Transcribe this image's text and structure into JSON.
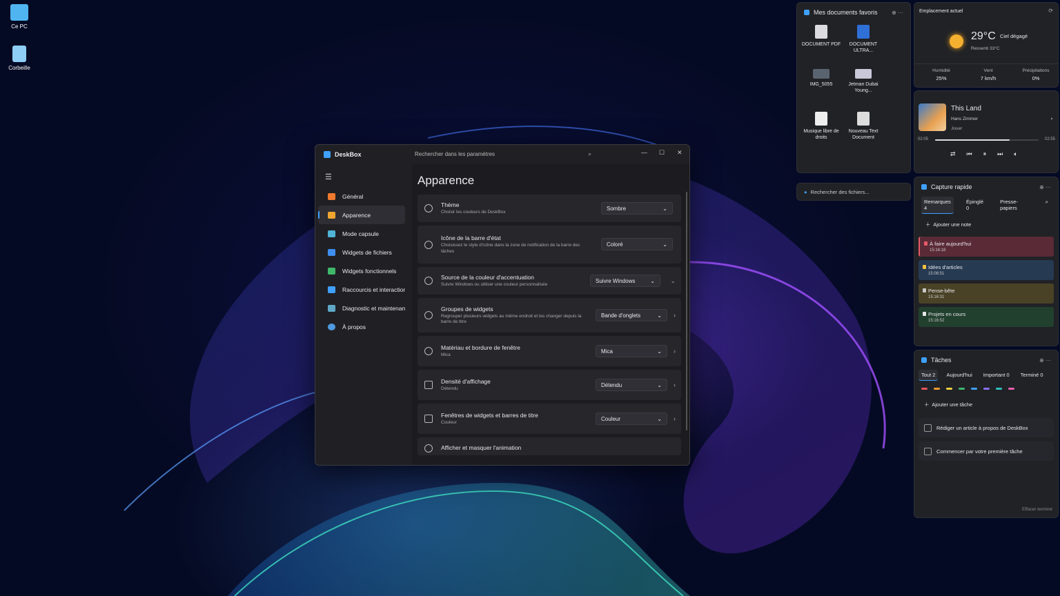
{
  "desktop": {
    "icons": [
      {
        "label": "Ce PC",
        "icon": "monitor-icon",
        "color": "#4fb4f0"
      },
      {
        "label": "Corbeille",
        "icon": "recycle-bin-icon",
        "color": "#8ecdf5"
      }
    ]
  },
  "window": {
    "app_title": "DeskBox",
    "search_placeholder": "Rechercher dans les paramètres",
    "minimize": "—",
    "maximize": "☐",
    "close": "✕",
    "nav": [
      {
        "label": "Général",
        "color": "#f07a2e"
      },
      {
        "label": "Apparence",
        "color": "#f0a530"
      },
      {
        "label": "Mode capsule",
        "color": "#4fb4d8"
      },
      {
        "label": "Widgets de fichiers",
        "color": "#3f8ef0"
      },
      {
        "label": "Widgets fonctionnels",
        "color": "#3fb86a"
      },
      {
        "label": "Raccourcis et interactions",
        "color": "#3fa0ff"
      },
      {
        "label": "Diagnostic et maintenance",
        "color": "#5fa8c8"
      },
      {
        "label": "À propos",
        "color": "#4f9ae0"
      }
    ],
    "page_title": "Apparence",
    "settings": [
      {
        "title": "Thème",
        "sub": "Choisir les couleurs de DeskBox",
        "value": "Sombre",
        "arrow": ""
      },
      {
        "title": "Icône de la barre d'état",
        "sub": "Choisissez le style d'icône dans la zone de notification de la barre des tâches",
        "value": "Coloré",
        "arrow": ""
      },
      {
        "title": "Source de la couleur d'accentuation",
        "sub": "Suivre Windows ou utiliser une couleur personnalisée",
        "value": "Suivre Windows",
        "arrow": "⌄"
      },
      {
        "title": "Groupes de widgets",
        "sub": "Regrouper plusieurs widgets au même endroit et les changer depuis la barre de titre",
        "value": "Bande d'onglets",
        "arrow": "›"
      },
      {
        "title": "Matériau et bordure de fenêtre",
        "sub": "Mica",
        "value": "Mica",
        "arrow": "›"
      },
      {
        "title": "Densité d'affichage",
        "sub": "Détendu",
        "value": "Détendu",
        "arrow": "›"
      },
      {
        "title": "Fenêtres de widgets et barres de titre",
        "sub": "Couleur",
        "value": "Couleur",
        "arrow": "›"
      },
      {
        "title": "Afficher et masquer l'animation",
        "sub": "",
        "value": "",
        "arrow": ""
      }
    ]
  },
  "favorites": {
    "title": "Mes documents favoris",
    "docs": [
      {
        "label": "DOCUMENT PDF",
        "color": "#dcdce0"
      },
      {
        "label": "DOCUMENT ULTRA...",
        "color": "#2f6fd8"
      },
      {
        "label": "IMG_5055",
        "color": "#5a6470"
      },
      {
        "label": "Jetman Dubai Young...",
        "color": "#c8c8d8"
      },
      {
        "label": "Musique libre de droits",
        "color": "#eeeeee"
      },
      {
        "label": "Nouveau Text Document",
        "color": "#dddddd"
      }
    ]
  },
  "file_search": {
    "placeholder": "Rechercher des fichiers..."
  },
  "weather": {
    "location": "Emplacement actuel",
    "temp": "29°C",
    "condition": "Ciel dégagé",
    "feels": "Ressenti 33°C",
    "stats": [
      {
        "label": "Humidité",
        "value": "25%"
      },
      {
        "label": "Vent",
        "value": "7 km/h"
      },
      {
        "label": "Précipitations",
        "value": "0%"
      }
    ]
  },
  "music": {
    "title": "This Land",
    "artist": "Hans Zimmer",
    "status": "Jouer",
    "elapsed": "02:05",
    "total": "02:55",
    "progress": 0.72
  },
  "quick_capture": {
    "title": "Capture rapide",
    "tabs": [
      "Remarques 4",
      "Épinglé 0",
      "Presse-papiers"
    ],
    "add": "Ajouter une note",
    "notes": [
      {
        "title": "À faire aujourd'hui",
        "time": "15:16:18",
        "bg": "#5a2a36",
        "ic": "#e85a6a"
      },
      {
        "title": "Idées d'articles",
        "time": "15:08:51",
        "bg": "#263a52",
        "ic": "#f0c040"
      },
      {
        "title": "Pense-bête",
        "time": "15:16:31",
        "bg": "#4a4226",
        "ic": "#c8c8c8"
      },
      {
        "title": "Projets en cours",
        "time": "15:16:52",
        "bg": "#22402e",
        "ic": "#e8e8e8"
      }
    ]
  },
  "tasks": {
    "title": "Tâches",
    "tabs": [
      "Tout 2",
      "Aujourd'hui",
      "Important 0",
      "Terminé 0"
    ],
    "add": "Ajouter une tâche",
    "colors": [
      "#e8555a",
      "#f09a30",
      "#f0d040",
      "#40b870",
      "#3fa0ff",
      "#8a70f0",
      "#30c0c0",
      "#f060b0"
    ],
    "items": [
      "Rédiger un article à propos de DeskBox",
      "Commencer par votre première tâche"
    ],
    "clear": "Effacer terminé"
  }
}
